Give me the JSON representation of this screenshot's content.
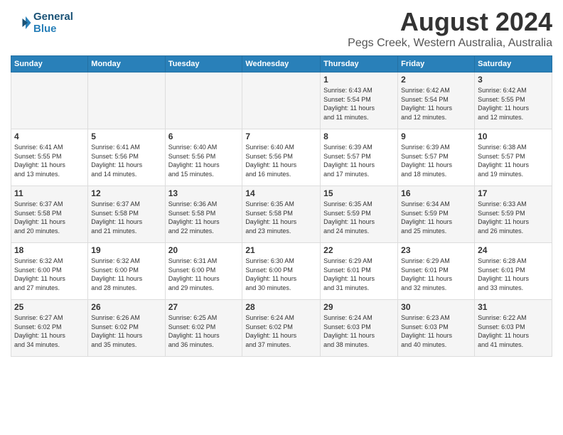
{
  "header": {
    "logo_line1": "General",
    "logo_line2": "Blue",
    "month_year": "August 2024",
    "location": "Pegs Creek, Western Australia, Australia"
  },
  "calendar": {
    "days_of_week": [
      "Sunday",
      "Monday",
      "Tuesday",
      "Wednesday",
      "Thursday",
      "Friday",
      "Saturday"
    ],
    "weeks": [
      [
        {
          "day": "",
          "info": ""
        },
        {
          "day": "",
          "info": ""
        },
        {
          "day": "",
          "info": ""
        },
        {
          "day": "",
          "info": ""
        },
        {
          "day": "1",
          "info": "Sunrise: 6:43 AM\nSunset: 5:54 PM\nDaylight: 11 hours\nand 11 minutes."
        },
        {
          "day": "2",
          "info": "Sunrise: 6:42 AM\nSunset: 5:54 PM\nDaylight: 11 hours\nand 12 minutes."
        },
        {
          "day": "3",
          "info": "Sunrise: 6:42 AM\nSunset: 5:55 PM\nDaylight: 11 hours\nand 12 minutes."
        }
      ],
      [
        {
          "day": "4",
          "info": "Sunrise: 6:41 AM\nSunset: 5:55 PM\nDaylight: 11 hours\nand 13 minutes."
        },
        {
          "day": "5",
          "info": "Sunrise: 6:41 AM\nSunset: 5:56 PM\nDaylight: 11 hours\nand 14 minutes."
        },
        {
          "day": "6",
          "info": "Sunrise: 6:40 AM\nSunset: 5:56 PM\nDaylight: 11 hours\nand 15 minutes."
        },
        {
          "day": "7",
          "info": "Sunrise: 6:40 AM\nSunset: 5:56 PM\nDaylight: 11 hours\nand 16 minutes."
        },
        {
          "day": "8",
          "info": "Sunrise: 6:39 AM\nSunset: 5:57 PM\nDaylight: 11 hours\nand 17 minutes."
        },
        {
          "day": "9",
          "info": "Sunrise: 6:39 AM\nSunset: 5:57 PM\nDaylight: 11 hours\nand 18 minutes."
        },
        {
          "day": "10",
          "info": "Sunrise: 6:38 AM\nSunset: 5:57 PM\nDaylight: 11 hours\nand 19 minutes."
        }
      ],
      [
        {
          "day": "11",
          "info": "Sunrise: 6:37 AM\nSunset: 5:58 PM\nDaylight: 11 hours\nand 20 minutes."
        },
        {
          "day": "12",
          "info": "Sunrise: 6:37 AM\nSunset: 5:58 PM\nDaylight: 11 hours\nand 21 minutes."
        },
        {
          "day": "13",
          "info": "Sunrise: 6:36 AM\nSunset: 5:58 PM\nDaylight: 11 hours\nand 22 minutes."
        },
        {
          "day": "14",
          "info": "Sunrise: 6:35 AM\nSunset: 5:58 PM\nDaylight: 11 hours\nand 23 minutes."
        },
        {
          "day": "15",
          "info": "Sunrise: 6:35 AM\nSunset: 5:59 PM\nDaylight: 11 hours\nand 24 minutes."
        },
        {
          "day": "16",
          "info": "Sunrise: 6:34 AM\nSunset: 5:59 PM\nDaylight: 11 hours\nand 25 minutes."
        },
        {
          "day": "17",
          "info": "Sunrise: 6:33 AM\nSunset: 5:59 PM\nDaylight: 11 hours\nand 26 minutes."
        }
      ],
      [
        {
          "day": "18",
          "info": "Sunrise: 6:32 AM\nSunset: 6:00 PM\nDaylight: 11 hours\nand 27 minutes."
        },
        {
          "day": "19",
          "info": "Sunrise: 6:32 AM\nSunset: 6:00 PM\nDaylight: 11 hours\nand 28 minutes."
        },
        {
          "day": "20",
          "info": "Sunrise: 6:31 AM\nSunset: 6:00 PM\nDaylight: 11 hours\nand 29 minutes."
        },
        {
          "day": "21",
          "info": "Sunrise: 6:30 AM\nSunset: 6:00 PM\nDaylight: 11 hours\nand 30 minutes."
        },
        {
          "day": "22",
          "info": "Sunrise: 6:29 AM\nSunset: 6:01 PM\nDaylight: 11 hours\nand 31 minutes."
        },
        {
          "day": "23",
          "info": "Sunrise: 6:29 AM\nSunset: 6:01 PM\nDaylight: 11 hours\nand 32 minutes."
        },
        {
          "day": "24",
          "info": "Sunrise: 6:28 AM\nSunset: 6:01 PM\nDaylight: 11 hours\nand 33 minutes."
        }
      ],
      [
        {
          "day": "25",
          "info": "Sunrise: 6:27 AM\nSunset: 6:02 PM\nDaylight: 11 hours\nand 34 minutes."
        },
        {
          "day": "26",
          "info": "Sunrise: 6:26 AM\nSunset: 6:02 PM\nDaylight: 11 hours\nand 35 minutes."
        },
        {
          "day": "27",
          "info": "Sunrise: 6:25 AM\nSunset: 6:02 PM\nDaylight: 11 hours\nand 36 minutes."
        },
        {
          "day": "28",
          "info": "Sunrise: 6:24 AM\nSunset: 6:02 PM\nDaylight: 11 hours\nand 37 minutes."
        },
        {
          "day": "29",
          "info": "Sunrise: 6:24 AM\nSunset: 6:03 PM\nDaylight: 11 hours\nand 38 minutes."
        },
        {
          "day": "30",
          "info": "Sunrise: 6:23 AM\nSunset: 6:03 PM\nDaylight: 11 hours\nand 40 minutes."
        },
        {
          "day": "31",
          "info": "Sunrise: 6:22 AM\nSunset: 6:03 PM\nDaylight: 11 hours\nand 41 minutes."
        }
      ]
    ]
  }
}
